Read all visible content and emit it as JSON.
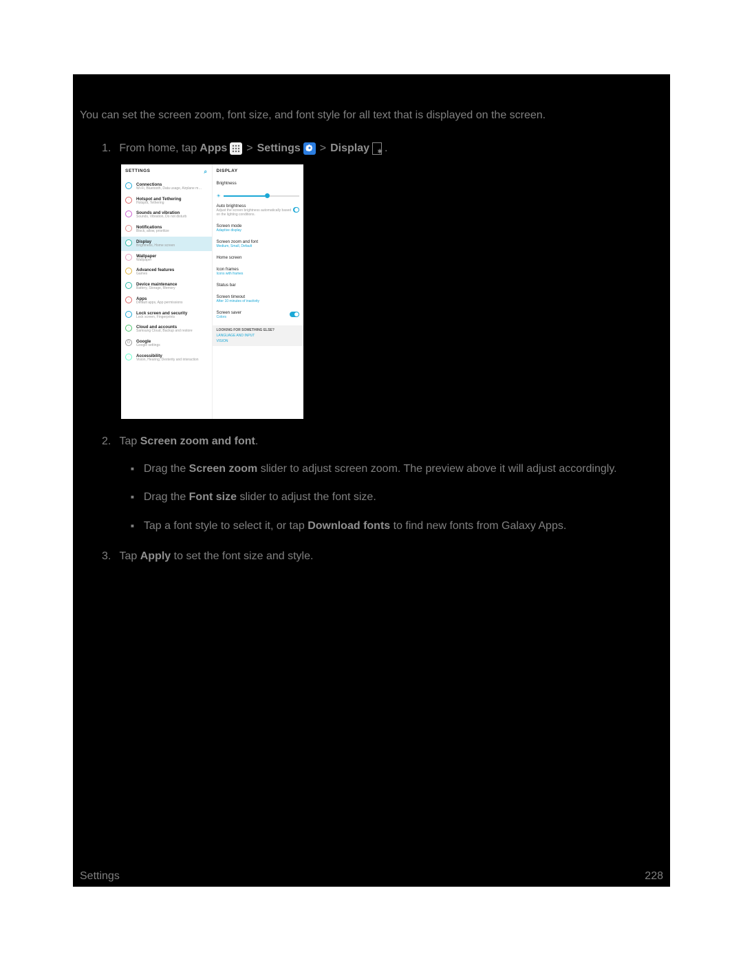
{
  "intro": "You can set the screen zoom, font size, and font style for all text that is displayed on the screen.",
  "step1": {
    "num": "1.",
    "pre": "From home, tap ",
    "apps": "Apps",
    "settings": "Settings",
    "display": "Display",
    "gt": ">",
    "period": "."
  },
  "shot": {
    "left_header": "SETTINGS",
    "right_header": "DISPLAY",
    "left_items": [
      {
        "icon": "·",
        "color": "#1ba8d6",
        "title": "Connections",
        "sub": "Wi-Fi, Bluetooth, Data usage, Airplane m…"
      },
      {
        "icon": "·",
        "color": "#d66",
        "title": "Hotspot and Tethering",
        "sub": "Hotspot, Tethering"
      },
      {
        "icon": "·",
        "color": "#c95ccf",
        "title": "Sounds and vibration",
        "sub": "Sounds, Vibration, Do not disturb"
      },
      {
        "icon": "·",
        "color": "#e08f8f",
        "title": "Notifications",
        "sub": "Block, allow, prioritize"
      },
      {
        "icon": "·",
        "color": "#2ab8a6",
        "title": "Display",
        "sub": "Brightness, Home screen",
        "selected": true
      },
      {
        "icon": "·",
        "color": "#e5a1c1",
        "title": "Wallpaper",
        "sub": "Wallpaper"
      },
      {
        "icon": "·",
        "color": "#e0b43c",
        "title": "Advanced features",
        "sub": "Games"
      },
      {
        "icon": "·",
        "color": "#2ab8a6",
        "title": "Device maintenance",
        "sub": "Battery, Storage, Memory"
      },
      {
        "icon": "·",
        "color": "#d66",
        "title": "Apps",
        "sub": "Default apps, App permissions"
      },
      {
        "icon": "·",
        "color": "#1ba8d6",
        "title": "Lock screen and security",
        "sub": "Lock screen, Fingerprints"
      },
      {
        "icon": "·",
        "color": "#4bc46d",
        "title": "Cloud and accounts",
        "sub": "Samsung Cloud, Backup and restore"
      },
      {
        "icon": "G",
        "color": "#999",
        "title": "Google",
        "sub": "Google settings"
      },
      {
        "icon": "·",
        "color": "#6fc",
        "title": "Accessibility",
        "sub": "Vision, Hearing, Dexterity and interaction"
      }
    ],
    "right": {
      "brightness": "Brightness",
      "auto_b_t": "Auto brightness",
      "auto_b_s": "Adjust the screen brightness automatically based on the lighting conditions.",
      "mode_t": "Screen mode",
      "mode_s": "Adaptive display",
      "zoom_t": "Screen zoom and font",
      "zoom_s": "Medium, Small, Default",
      "home": "Home screen",
      "frames_t": "Icon frames",
      "frames_s": "Icons with frames",
      "status": "Status bar",
      "timeout_t": "Screen timeout",
      "timeout_s": "After 10 minutes of inactivity",
      "saver_t": "Screen saver",
      "saver_s": "Colors",
      "looking_h": "LOOKING FOR SOMETHING ELSE?",
      "looking_1": "LANGUAGE AND INPUT",
      "looking_2": "VISION"
    }
  },
  "step2": {
    "num": "2.",
    "pre": "Tap ",
    "bold": "Screen zoom and font",
    "post": "."
  },
  "sub1": {
    "pre": "Drag the ",
    "bold": "Screen zoom",
    "post": " slider to adjust screen zoom. The preview above it will adjust accordingly."
  },
  "sub2": {
    "pre": "Drag the ",
    "bold": "Font size",
    "post": " slider to adjust the font size."
  },
  "sub3": {
    "pre": "Tap a font style to select it, or tap ",
    "bold": "Download fonts",
    "post": " to find new fonts from Galaxy Apps."
  },
  "step3": {
    "num": "3.",
    "pre": "Tap ",
    "bold": "Apply",
    "post": " to set the font size and style."
  },
  "footer": {
    "left": "Settings",
    "right": "228"
  }
}
